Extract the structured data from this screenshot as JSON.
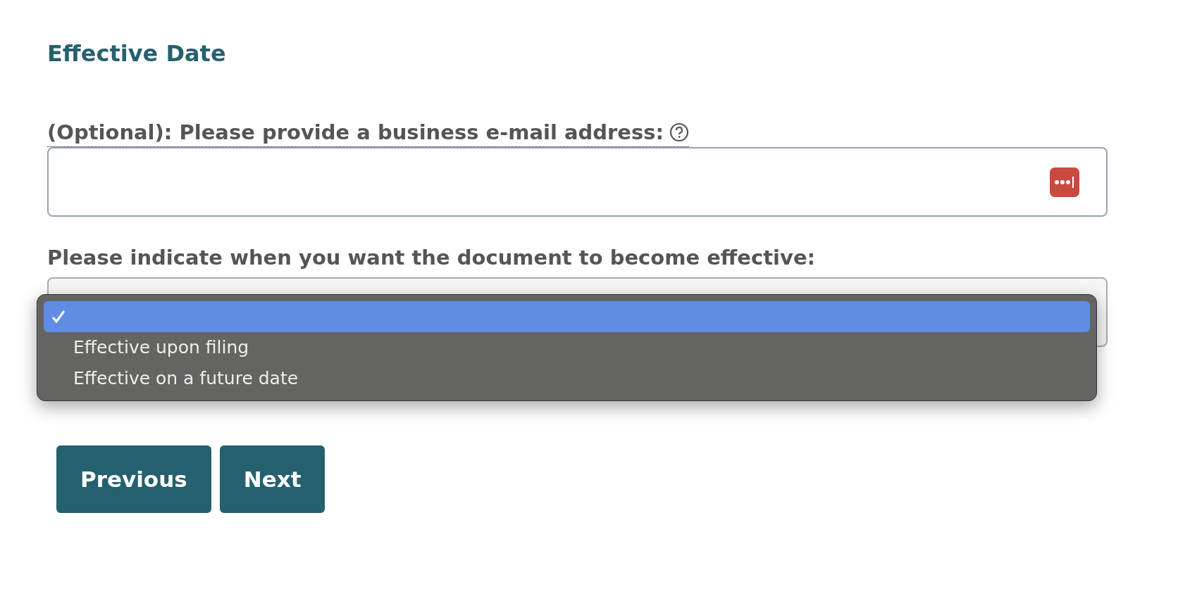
{
  "heading": "Effective Date",
  "email_field": {
    "label": "(Optional): Please provide a business e-mail address:"
  },
  "effective_select": {
    "label": "Please indicate when you want the document to become effective:",
    "expanded": true,
    "options": [
      {
        "selected": true
      },
      {
        "label": "Effective upon filing",
        "selected": false
      },
      {
        "label": "Effective on a future date",
        "selected": false
      }
    ]
  },
  "buttons": [
    {
      "label": "Previous"
    },
    {
      "label": "Next"
    }
  ]
}
